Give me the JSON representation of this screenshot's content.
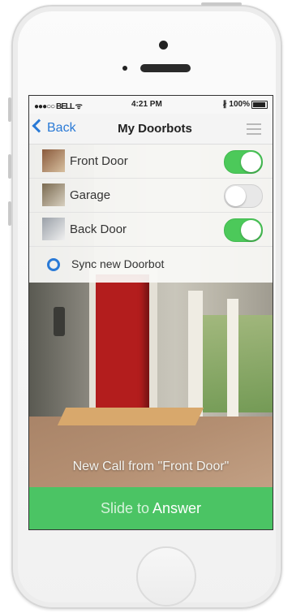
{
  "status_bar": {
    "carrier": "●●●○○ BELL ᯤ",
    "time": "4:21 PM",
    "battery": "∦ 100%"
  },
  "nav": {
    "back_label": "Back",
    "title": "My Doorbots"
  },
  "doorbots": [
    {
      "name": "Front Door",
      "enabled": true
    },
    {
      "name": "Garage",
      "enabled": false
    },
    {
      "name": "Back Door",
      "enabled": true
    }
  ],
  "sync_label": "Sync new Doorbot",
  "call": {
    "message": "New Call from \"Front Door\"",
    "slide_prefix": "Slide to",
    "slide_action": "Answer"
  },
  "colors": {
    "accent": "#2a7ad6",
    "toggle_on": "#4cc95a",
    "answer_bar": "#4bc464"
  }
}
